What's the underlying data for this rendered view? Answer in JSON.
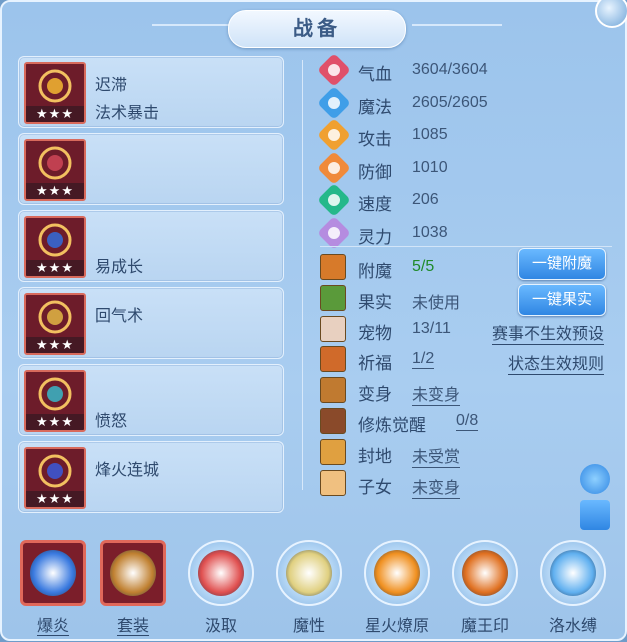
{
  "title": "战备",
  "equipment": [
    {
      "line1": "迟滞",
      "line2": "法术暴击",
      "stars": "★★★",
      "color": "#7a2030",
      "accent": "#e0a030"
    },
    {
      "line1": "",
      "line2": "",
      "stars": "★★★",
      "color": "#7a2030",
      "accent": "#c04050"
    },
    {
      "line1": "",
      "line2": "易成长",
      "stars": "★★★",
      "color": "#7a2030",
      "accent": "#3a60c0"
    },
    {
      "line1": "回气术",
      "line2": "",
      "stars": "★★★",
      "color": "#7a2030",
      "accent": "#d0a040"
    },
    {
      "line1": "",
      "line2": "愤怒",
      "stars": "★★★",
      "color": "#7a2030",
      "accent": "#40a0b0"
    },
    {
      "line1": "烽火连城",
      "line2": "",
      "stars": "★★★",
      "color": "#7a2030",
      "accent": "#4050c0"
    }
  ],
  "stats": [
    {
      "label": "气血",
      "value": "3604/3604",
      "icon": "heart-icon",
      "color": "#e0506a"
    },
    {
      "label": "魔法",
      "value": "2605/2605",
      "icon": "mana-icon",
      "color": "#3f9ee8"
    },
    {
      "label": "攻击",
      "value": "1085",
      "icon": "sword-icon",
      "color": "#f0a030"
    },
    {
      "label": "防御",
      "value": "1010",
      "icon": "shield-icon",
      "color": "#f08a3a"
    },
    {
      "label": "速度",
      "value": "206",
      "icon": "speed-icon",
      "color": "#25b88a"
    },
    {
      "label": "灵力",
      "value": "1038",
      "icon": "spirit-icon",
      "color": "#b58ce0"
    }
  ],
  "extras": [
    {
      "label": "附魔",
      "value": "5/5",
      "icon": "enchant-icon",
      "color": "#d77a2a",
      "style": "green"
    },
    {
      "label": "果实",
      "value": "未使用",
      "icon": "fruit-icon",
      "color": "#5a9a3a",
      "style": "plain"
    },
    {
      "label": "宠物",
      "value": "13/11",
      "icon": "pet-icon",
      "color": "#e8d0c0",
      "style": "plain"
    },
    {
      "label": "祈福",
      "value": "1/2",
      "icon": "blessing-icon",
      "color": "#d06a2a",
      "style": "u"
    },
    {
      "label": "变身",
      "value": "未变身",
      "icon": "transform-icon",
      "color": "#c07a30",
      "style": "u"
    },
    {
      "label": "修炼觉醒",
      "value": "0/8",
      "icon": "training-icon",
      "color": "#8a4a2a",
      "style": "u"
    },
    {
      "label": "封地",
      "value": "未受赏",
      "icon": "fief-icon",
      "color": "#e0a040",
      "style": "u"
    },
    {
      "label": "子女",
      "value": "未变身",
      "icon": "child-icon",
      "color": "#f0c080",
      "style": "u"
    }
  ],
  "buttons": {
    "enchant": "一键附魔",
    "fruit": "一键果实",
    "rule1": "赛事不生效预设",
    "rule2": "状态生效规则"
  },
  "skills": [
    {
      "label": "爆炎",
      "style": "sq",
      "color": "#3a7ae0"
    },
    {
      "label": "套装",
      "style": "sq",
      "color": "#c08030"
    },
    {
      "label": "汲取",
      "style": "round",
      "color": "#e05050"
    },
    {
      "label": "魔性",
      "style": "round",
      "color": "#e0d080"
    },
    {
      "label": "星火燎原",
      "style": "round",
      "color": "#f09020"
    },
    {
      "label": "魔王印",
      "style": "round",
      "color": "#e07020"
    },
    {
      "label": "洛水缚",
      "style": "round",
      "color": "#60b0f0"
    }
  ]
}
